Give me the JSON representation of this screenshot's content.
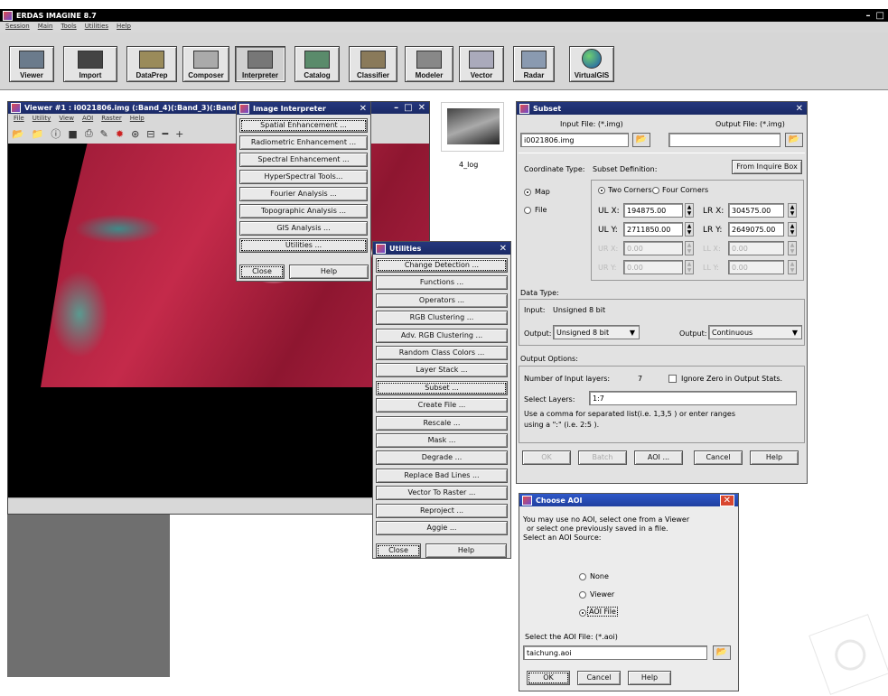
{
  "app": {
    "title": "ERDAS IMAGINE 8.7",
    "menu": [
      "Session",
      "Main",
      "Tools",
      "Utilities",
      "Help"
    ],
    "toolbar": [
      {
        "label": "Viewer",
        "icon": "viewer-icon"
      },
      {
        "label": "Import",
        "icon": "import-icon"
      },
      {
        "label": "DataPrep",
        "icon": "dataprep-icon"
      },
      {
        "label": "Composer",
        "icon": "composer-icon"
      },
      {
        "label": "Interpreter",
        "icon": "interpreter-icon"
      },
      {
        "label": "Catalog",
        "icon": "catalog-icon"
      },
      {
        "label": "Classifier",
        "icon": "classifier-icon"
      },
      {
        "label": "Modeler",
        "icon": "modeler-icon"
      },
      {
        "label": "Vector",
        "icon": "vector-icon"
      },
      {
        "label": "Radar",
        "icon": "radar-icon"
      },
      {
        "label": "VirtualGIS",
        "icon": "globe-icon"
      }
    ]
  },
  "viewer": {
    "title": "Viewer #1 : i0021806.img (:Band_4)(:Band_3)(:Band_2)",
    "menu": [
      "File",
      "Utility",
      "View",
      "AOI",
      "Raster",
      "Help"
    ]
  },
  "thumbnail": {
    "label": "4_log"
  },
  "image_interpreter": {
    "title": "Image Interpreter",
    "items": [
      "Spatial Enhancement ...",
      "Radiometric Enhancement ...",
      "Spectral Enhancement ...",
      "HyperSpectral Tools...",
      "Fourier Analysis ...",
      "Topographic Analysis ...",
      "GIS Analysis ...",
      "Utilities ..."
    ],
    "close": "Close",
    "help": "Help"
  },
  "utilities": {
    "title": "Utilities",
    "items": [
      "Change Detection ...",
      "Functions ...",
      "Operators ...",
      "RGB Clustering ...",
      "Adv. RGB Clustering ...",
      "Random Class Colors ...",
      "Layer Stack ...",
      "Subset ...",
      "Create File ...",
      "Rescale ...",
      "Mask ...",
      "Degrade ...",
      "Replace Bad Lines ...",
      "Vector To Raster ...",
      "Reproject ...",
      "Aggie ..."
    ],
    "close": "Close",
    "help": "Help"
  },
  "subset": {
    "title": "Subset",
    "input_label": "Input File: (*.img)",
    "output_label": "Output File: (*.img)",
    "input_value": "i0021806.img",
    "output_value": "",
    "coord_type_label": "Coordinate Type:",
    "subset_def_label": "Subset Definition:",
    "from_inquire": "From Inquire Box",
    "map_label": "Map",
    "file_label": "File",
    "two_corners": "Two Corners",
    "four_corners": "Four Corners",
    "ulx_label": "UL X:",
    "ulx": "194875.00",
    "lrx_label": "LR X:",
    "lrx": "304575.00",
    "uly_label": "UL Y:",
    "uly": "2711850.00",
    "lry_label": "LR Y:",
    "lry": "2649075.00",
    "urx_label": "UR X:",
    "llx_label": "LL X:",
    "ury_label": "UR Y:",
    "lly_label": "LL Y:",
    "zero": "0.00",
    "data_type_label": "Data Type:",
    "input_type_label": "Input:",
    "input_type": "Unsigned 8 bit",
    "output_label1": "Output:",
    "output_type": "Unsigned 8 bit",
    "output_label2": "Output:",
    "output_mode": "Continuous",
    "output_options_label": "Output Options:",
    "num_layers_label": "Number of Input layers:",
    "num_layers": "7",
    "ignore_zero": "Ignore Zero in Output Stats.",
    "select_layers_label": "Select Layers:",
    "select_layers": "1:7",
    "hint_line1": "Use a comma for separated list(i.e. 1,3,5 ) or enter ranges",
    "hint_line2": "using a \":\" (i.e. 2:5 ).",
    "btn_ok": "OK",
    "btn_batch": "Batch",
    "btn_aoi": "AOI ...",
    "btn_cancel": "Cancel",
    "btn_help": "Help"
  },
  "choose_aoi": {
    "title": "Choose AOI",
    "desc1": "You may use no AOI, select one from a Viewer",
    "desc2": "or select one previously saved in a file.",
    "desc3": "Select an AOI Source:",
    "options": [
      "None",
      "Viewer",
      "AOI File"
    ],
    "file_label": "Select the AOI File: (*.aoi)",
    "file_value": "taichung.aoi",
    "ok": "OK",
    "cancel": "Cancel",
    "help": "Help"
  }
}
